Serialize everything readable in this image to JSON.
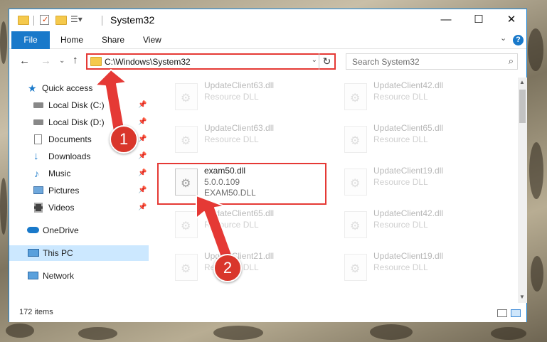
{
  "window": {
    "title": "System32",
    "controls": {
      "minimize": "—",
      "maximize": "☐",
      "close": "✕"
    }
  },
  "ribbon": {
    "tabs": [
      "File",
      "Home",
      "Share",
      "View"
    ],
    "expand": "⌄",
    "help": "?"
  },
  "address": {
    "path": "C:\\Windows\\System32",
    "search_placeholder": "Search System32"
  },
  "nav": {
    "items": [
      {
        "label": "Quick access",
        "icon": "star-icon",
        "pinned": false
      },
      {
        "label": "Local Disk (C:)",
        "icon": "drive-icon",
        "pinned": true
      },
      {
        "label": "Local Disk (D:)",
        "icon": "drive-icon",
        "pinned": true
      },
      {
        "label": "Documents",
        "icon": "documents-icon",
        "pinned": true
      },
      {
        "label": "Downloads",
        "icon": "download-icon",
        "pinned": true
      },
      {
        "label": "Music",
        "icon": "music-icon",
        "pinned": true
      },
      {
        "label": "Pictures",
        "icon": "pictures-icon",
        "pinned": true
      },
      {
        "label": "Videos",
        "icon": "videos-icon",
        "pinned": true
      },
      {
        "label": "OneDrive",
        "icon": "cloud-icon",
        "pinned": false
      },
      {
        "label": "This PC",
        "icon": "computer-icon",
        "pinned": false,
        "selected": true
      },
      {
        "label": "Network",
        "icon": "network-icon",
        "pinned": false
      }
    ]
  },
  "files": [
    {
      "name": "UpdateClient63.dll",
      "sub": "Resource DLL"
    },
    {
      "name": "UpdateClient42.dll",
      "sub": "Resource DLL"
    },
    {
      "name": "UpdateClient63.dll",
      "sub": "Resource DLL"
    },
    {
      "name": "UpdateClient65.dll",
      "sub": "Resource DLL"
    },
    {
      "name": "exam50.dll",
      "sub": "5.0.0.109",
      "sub2": "EXAM50.DLL",
      "highlighted": true
    },
    {
      "name": "UpdateClient19.dll",
      "sub": "Resource DLL"
    },
    {
      "name": "UpdateClient65.dll",
      "sub": "Resource DLL"
    },
    {
      "name": "UpdateClient42.dll",
      "sub": "Resource DLL"
    },
    {
      "name": "UpdateClient21.dll",
      "sub": "Resource DLL"
    },
    {
      "name": "UpdateClient19.dll",
      "sub": "Resource DLL"
    }
  ],
  "status": {
    "count": "172 items"
  },
  "annotations": {
    "step1": "1",
    "step2": "2"
  },
  "colors": {
    "accent": "#1979ca",
    "highlight": "#e53935",
    "badge": "#d9362b"
  }
}
